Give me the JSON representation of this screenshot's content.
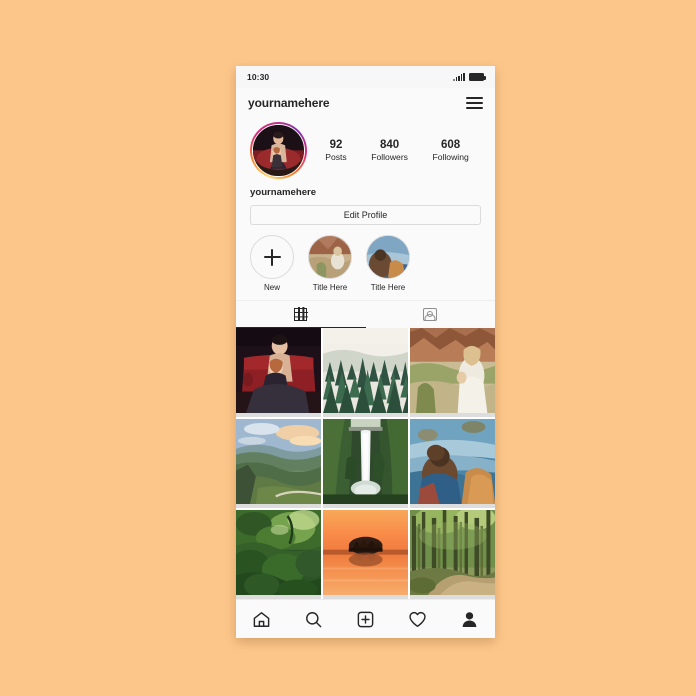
{
  "background_color": "#FCC68A",
  "phone": {
    "status_bar": {
      "time": "10:30",
      "signal_icon": "signal-bars-icon",
      "battery_icon": "battery-full-icon"
    },
    "header": {
      "title": "yournamehere",
      "menu_icon": "hamburger-menu-icon"
    },
    "profile": {
      "avatar_name": "profile-avatar",
      "avatar_has_story_ring": true,
      "ring_colors": [
        "#FEDA77",
        "#F58529",
        "#DD2A7B",
        "#C13584",
        "#8134AF"
      ],
      "display_name": "yournamehere",
      "stats": [
        {
          "value": "92",
          "label": "Posts"
        },
        {
          "value": "840",
          "label": "Followers"
        },
        {
          "value": "608",
          "label": "Following"
        }
      ],
      "edit_button_label": "Edit Profile"
    },
    "highlights": [
      {
        "label": "New",
        "icon": "plus-icon",
        "type": "new"
      },
      {
        "label": "Title Here",
        "type": "photo",
        "theme": "canyon"
      },
      {
        "label": "Title Here",
        "type": "photo",
        "theme": "coast"
      }
    ],
    "tabs": [
      {
        "name": "grid",
        "icon": "grid-icon",
        "active": true
      },
      {
        "name": "tagged",
        "icon": "tagged-person-icon",
        "active": false
      }
    ],
    "posts": [
      {
        "alt": "portrait-on-red-sofa"
      },
      {
        "alt": "misty-pine-forest"
      },
      {
        "alt": "woman-in-canyon"
      },
      {
        "alt": "mountain-valley-sunrise"
      },
      {
        "alt": "tall-waterfall"
      },
      {
        "alt": "person-overlooking-coast"
      },
      {
        "alt": "sunlit-green-forest"
      },
      {
        "alt": "orange-sunset-lake-island"
      },
      {
        "alt": "forest-path-trees"
      }
    ],
    "bottom_nav": [
      {
        "name": "home",
        "icon": "home-icon"
      },
      {
        "name": "search",
        "icon": "search-icon"
      },
      {
        "name": "add-post",
        "icon": "plus-square-icon"
      },
      {
        "name": "activity",
        "icon": "heart-icon"
      },
      {
        "name": "profile",
        "icon": "person-filled-icon"
      }
    ]
  }
}
